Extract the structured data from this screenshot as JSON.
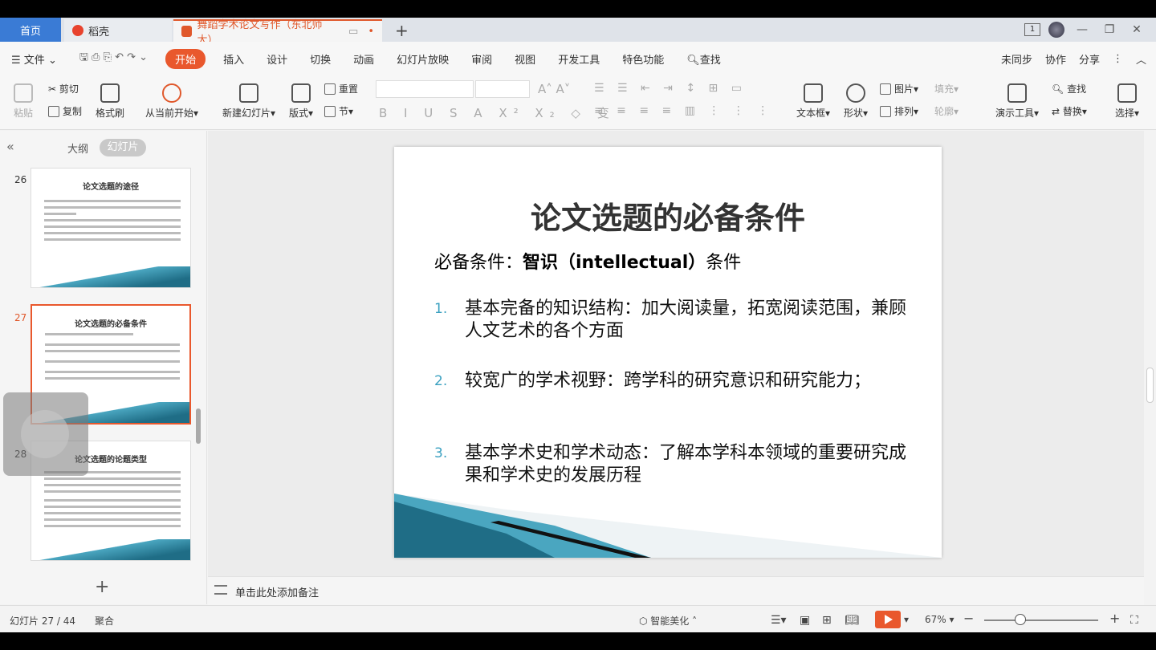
{
  "tabs": {
    "home": "首页",
    "daoke": "稻壳",
    "doc": "舞蹈学术论文写作（东北师大）",
    "new_tab": "+"
  },
  "window": {
    "badge": "1"
  },
  "menu": {
    "file": "文件",
    "items": [
      "开始",
      "插入",
      "设计",
      "切换",
      "动画",
      "幻灯片放映",
      "审阅",
      "视图",
      "开发工具",
      "特色功能"
    ],
    "search": "查找",
    "right": [
      "未同步",
      "协作",
      "分享"
    ]
  },
  "ribbon": {
    "paste": "粘贴",
    "cut": "剪切",
    "copy": "复制",
    "format_painter": "格式刷",
    "from_current": "从当前开始",
    "new_slide": "新建幻灯片",
    "layout": "版式",
    "reset": "重置",
    "section": "节",
    "textbox": "文本框",
    "shape": "形状",
    "picture": "图片",
    "fill": "填充",
    "arrange": "排列",
    "outline": "轮廓",
    "presenter": "演示工具",
    "find": "查找",
    "replace": "替换",
    "select": "选择"
  },
  "left_panel": {
    "outline_tab": "大纲",
    "slides_tab": "幻灯片",
    "add": "+",
    "thumbnails": [
      {
        "num": "26",
        "title": "论文选题的途径"
      },
      {
        "num": "27",
        "title": "论文选题的必备条件"
      },
      {
        "num": "28",
        "title": "论文选题的论题类型"
      }
    ]
  },
  "slide": {
    "title": "论文选题的必备条件",
    "subtitle_prefix": "必备条件：",
    "subtitle_bold": "智识（intellectual）",
    "subtitle_suffix": "条件",
    "points": [
      {
        "n": "1.",
        "text": "基本完备的知识结构：加大阅读量，拓宽阅读范围，兼顾人文艺术的各个方面"
      },
      {
        "n": "2.",
        "text": "较宽广的学术视野：跨学科的研究意识和研究能力；"
      },
      {
        "n": "3.",
        "text": "基本学术史和学术动态：了解本学科本领域的重要研究成果和学术史的发展历程"
      }
    ]
  },
  "notes": {
    "placeholder": "单击此处添加备注"
  },
  "status": {
    "slide_pos": "幻灯片 27 / 44",
    "theme": "聚合",
    "beautify": "智能美化",
    "zoom": "67%",
    "minus": "−",
    "plus": "+"
  },
  "colors": {
    "accent": "#e9582d",
    "home_tab": "#3a7bd5",
    "band_dark": "#1f6d86",
    "band_light": "#4aa6c0"
  }
}
